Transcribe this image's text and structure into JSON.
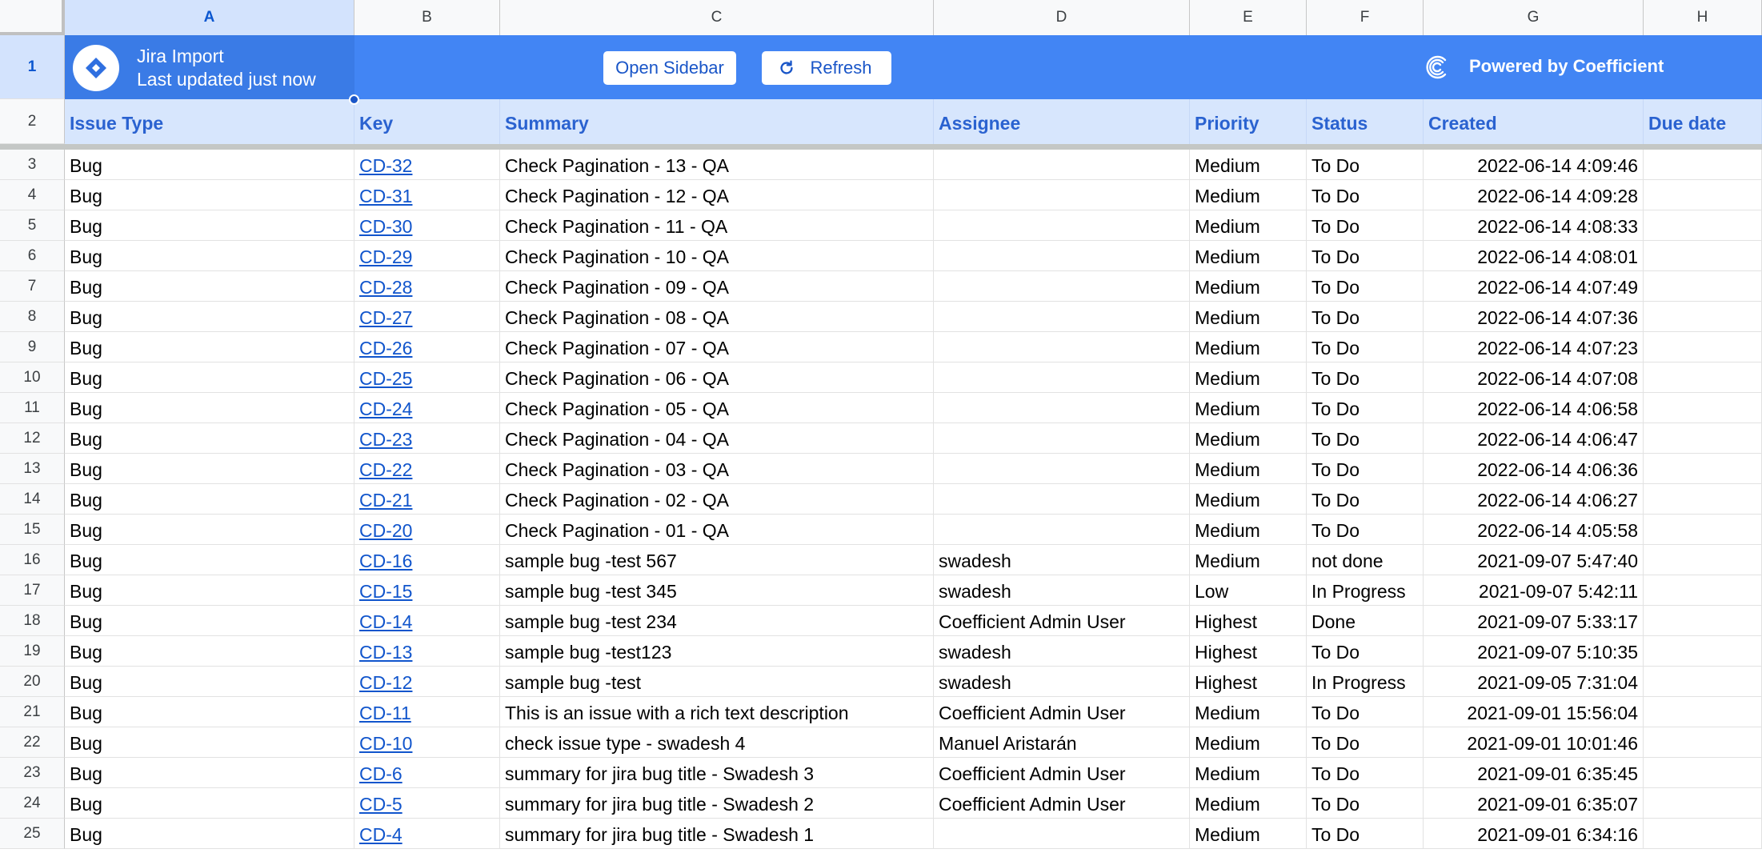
{
  "columns": [
    "A",
    "B",
    "C",
    "D",
    "E",
    "F",
    "G",
    "H"
  ],
  "banner": {
    "title": "Jira Import",
    "subtitle": "Last updated just now",
    "open_sidebar": "Open Sidebar",
    "refresh": "Refresh",
    "powered": "Powered by Coefficient"
  },
  "headers": [
    "Issue Type",
    "Key",
    "Summary",
    "Assignee",
    "Priority",
    "Status",
    "Created",
    "Due date"
  ],
  "row_numbers": [
    "1",
    "2",
    "3",
    "4",
    "5",
    "6",
    "7",
    "8",
    "9",
    "10",
    "11",
    "12",
    "13",
    "14",
    "15",
    "16",
    "17",
    "18",
    "19",
    "20",
    "21",
    "22",
    "23",
    "24",
    "25"
  ],
  "rows": [
    [
      "Bug",
      "CD-32",
      "Check Pagination - 13 - QA",
      "",
      "Medium",
      "To Do",
      "2022-06-14 4:09:46"
    ],
    [
      "Bug",
      "CD-31",
      "Check Pagination - 12 - QA",
      "",
      "Medium",
      "To Do",
      "2022-06-14 4:09:28"
    ],
    [
      "Bug",
      "CD-30",
      "Check Pagination - 11 - QA",
      "",
      "Medium",
      "To Do",
      "2022-06-14 4:08:33"
    ],
    [
      "Bug",
      "CD-29",
      "Check Pagination - 10 - QA",
      "",
      "Medium",
      "To Do",
      "2022-06-14 4:08:01"
    ],
    [
      "Bug",
      "CD-28",
      "Check Pagination - 09 - QA",
      "",
      "Medium",
      "To Do",
      "2022-06-14 4:07:49"
    ],
    [
      "Bug",
      "CD-27",
      "Check Pagination - 08 - QA",
      "",
      "Medium",
      "To Do",
      "2022-06-14 4:07:36"
    ],
    [
      "Bug",
      "CD-26",
      "Check Pagination - 07 - QA",
      "",
      "Medium",
      "To Do",
      "2022-06-14 4:07:23"
    ],
    [
      "Bug",
      "CD-25",
      "Check Pagination - 06 - QA",
      "",
      "Medium",
      "To Do",
      "2022-06-14 4:07:08"
    ],
    [
      "Bug",
      "CD-24",
      "Check Pagination - 05 - QA",
      "",
      "Medium",
      "To Do",
      "2022-06-14 4:06:58"
    ],
    [
      "Bug",
      "CD-23",
      "Check Pagination - 04 - QA",
      "",
      "Medium",
      "To Do",
      "2022-06-14 4:06:47"
    ],
    [
      "Bug",
      "CD-22",
      "Check Pagination - 03 - QA",
      "",
      "Medium",
      "To Do",
      "2022-06-14 4:06:36"
    ],
    [
      "Bug",
      "CD-21",
      "Check Pagination - 02 - QA",
      "",
      "Medium",
      "To Do",
      "2022-06-14 4:06:27"
    ],
    [
      "Bug",
      "CD-20",
      "Check Pagination - 01 - QA",
      "",
      "Medium",
      "To Do",
      "2022-06-14 4:05:58"
    ],
    [
      "Bug",
      "CD-16",
      "sample bug -test 567",
      "swadesh",
      "Medium",
      "not done",
      "2021-09-07 5:47:40"
    ],
    [
      "Bug",
      "CD-15",
      "sample bug -test 345",
      "swadesh",
      "Low",
      "In Progress",
      "2021-09-07 5:42:11"
    ],
    [
      "Bug",
      "CD-14",
      "sample bug -test 234",
      "Coefficient Admin User",
      "Highest",
      "Done",
      "2021-09-07 5:33:17"
    ],
    [
      "Bug",
      "CD-13",
      "sample bug -test123",
      "swadesh",
      "Highest",
      "To Do",
      "2021-09-07 5:10:35"
    ],
    [
      "Bug",
      "CD-12",
      "sample bug -test",
      "swadesh",
      "Highest",
      "In Progress",
      "2021-09-05 7:31:04"
    ],
    [
      "Bug",
      "CD-11",
      "This is an issue with a rich text description",
      "Coefficient Admin User",
      "Medium",
      "To Do",
      "2021-09-01 15:56:04"
    ],
    [
      "Bug",
      "CD-10",
      "check issue type - swadesh 4",
      "Manuel Aristarán",
      "Medium",
      "To Do",
      "2021-09-01 10:01:46"
    ],
    [
      "Bug",
      "CD-6",
      "summary for jira bug title - Swadesh 3",
      "Coefficient Admin User",
      "Medium",
      "To Do",
      "2021-09-01 6:35:45"
    ],
    [
      "Bug",
      "CD-5",
      "summary for jira bug title - Swadesh 2",
      "Coefficient Admin User",
      "Medium",
      "To Do",
      "2021-09-01 6:35:07"
    ],
    [
      "Bug",
      "CD-4",
      "summary for jira bug title - Swadesh 1",
      "",
      "Medium",
      "To Do",
      "2021-09-01 6:34:16"
    ]
  ],
  "colors": {
    "banner": "#4285f4",
    "header_bg": "#d7e6fd",
    "header_text": "#2a62d0",
    "link": "#1155cc"
  }
}
